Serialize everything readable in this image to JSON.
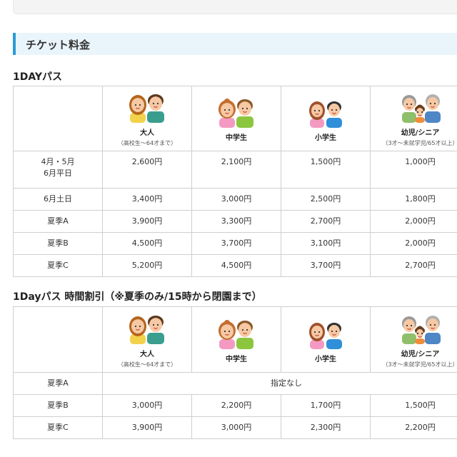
{
  "section": {
    "title": "チケット料金"
  },
  "categories": [
    {
      "name": "大人",
      "note": "（高校生〜64才まで）",
      "icon": "adult-couple-icon"
    },
    {
      "name": "中学生",
      "note": "",
      "icon": "junior-high-couple-icon"
    },
    {
      "name": "小学生",
      "note": "",
      "icon": "elementary-couple-icon"
    },
    {
      "name": "幼児/シニア",
      "note": "（3才〜未就学児/65才以上）",
      "icon": "infant-senior-icon"
    }
  ],
  "table1": {
    "title": "1DAYパス",
    "rows": [
      {
        "label": "4月・5月\n6月平日",
        "values": [
          "2,600円",
          "2,100円",
          "1,500円",
          "1,000円"
        ]
      },
      {
        "label": "6月土日",
        "values": [
          "3,400円",
          "3,000円",
          "2,500円",
          "1,800円"
        ]
      },
      {
        "label": "夏季A",
        "values": [
          "3,900円",
          "3,300円",
          "2,700円",
          "2,000円"
        ]
      },
      {
        "label": "夏季B",
        "values": [
          "4,500円",
          "3,700円",
          "3,100円",
          "2,000円"
        ]
      },
      {
        "label": "夏季C",
        "values": [
          "5,200円",
          "4,500円",
          "3,700円",
          "2,700円"
        ]
      }
    ]
  },
  "table2": {
    "title": "1Dayパス 時間割引（※夏季のみ/15時から閉園まで）",
    "rows": [
      {
        "label": "夏季A",
        "merged": "指定なし"
      },
      {
        "label": "夏季B",
        "values": [
          "3,000円",
          "2,200円",
          "1,700円",
          "1,500円"
        ]
      },
      {
        "label": "夏季C",
        "values": [
          "3,900円",
          "3,000円",
          "2,300円",
          "2,200円"
        ]
      }
    ]
  },
  "colors": {
    "accent": "#2b9bd6",
    "header_bg": "#eaf4fb",
    "border": "#cfcfcf"
  }
}
